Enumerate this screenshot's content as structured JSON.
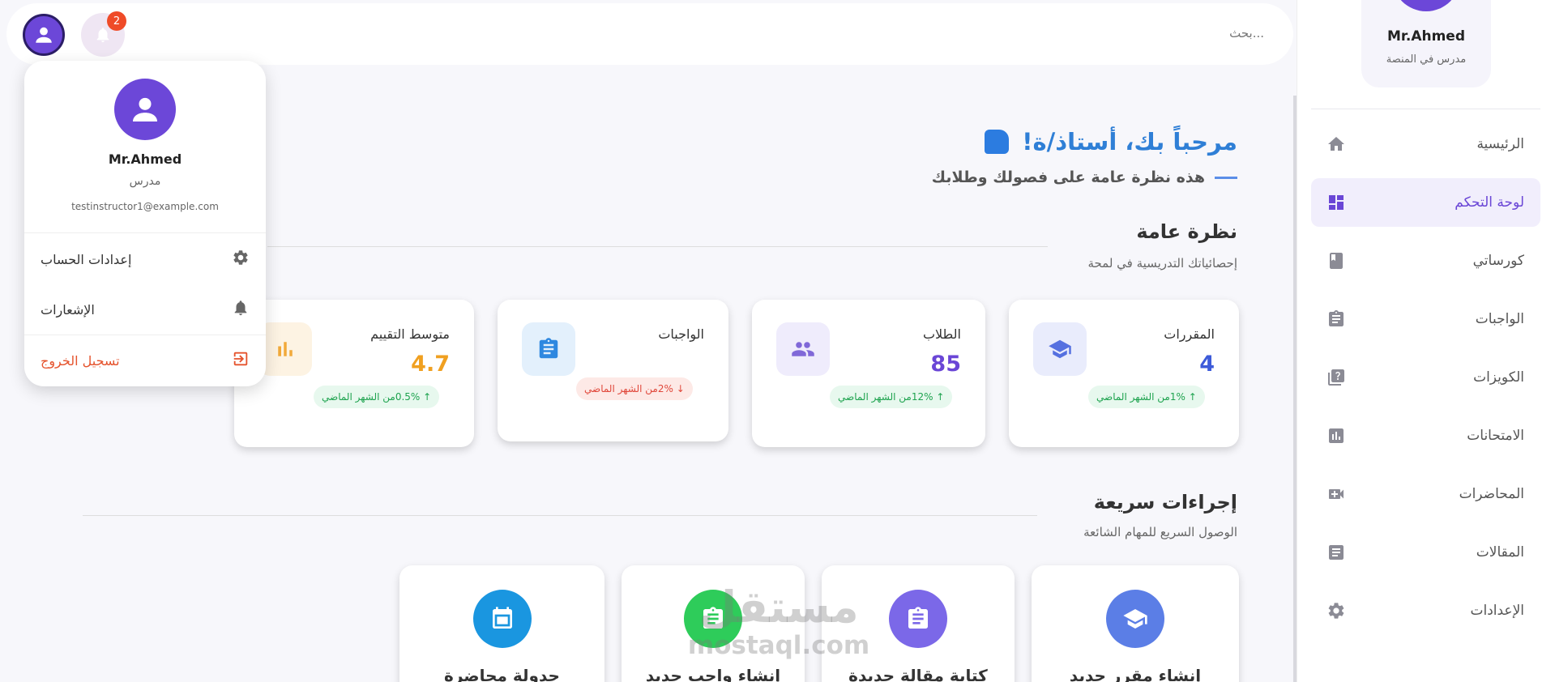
{
  "sidebar": {
    "profile_name": "Mr.Ahmed",
    "profile_role": "مدرس في المنصة",
    "items": [
      {
        "label": "الرئيسية",
        "icon": "home-icon",
        "active": false
      },
      {
        "label": "لوحة التحكم",
        "icon": "dashboard-icon",
        "active": true
      },
      {
        "label": "كورساتي",
        "icon": "book-icon",
        "active": false
      },
      {
        "label": "الواجبات",
        "icon": "clipboard-icon",
        "active": false
      },
      {
        "label": "الكويزات",
        "icon": "quiz-icon",
        "active": false
      },
      {
        "label": "الامتحانات",
        "icon": "chart-icon",
        "active": false
      },
      {
        "label": "المحاضرات",
        "icon": "video-icon",
        "active": false
      },
      {
        "label": "المقالات",
        "icon": "article-icon",
        "active": false
      },
      {
        "label": "الإعدادات",
        "icon": "gear-icon",
        "active": false
      }
    ]
  },
  "topbar": {
    "search_placeholder": "بحث...",
    "notification_count": "2"
  },
  "welcome": {
    "title": "مرحباً بك، أستاذ/ة!",
    "subtitle": "هذه نظرة عامة على فصولك وطلابك"
  },
  "overview": {
    "title": "نظرة عامة",
    "subtitle": "إحصائياتك التدريسية في لمحة",
    "stats": [
      {
        "label": "المقررات",
        "value": "4",
        "change": "↑ 1%من الشهر الماضي",
        "trend": "up",
        "color": "#3d5bd9",
        "icon_bg": "#e9ecfc",
        "icon_color": "#5570e0"
      },
      {
        "label": "الطلاب",
        "value": "85",
        "change": "↑ 12%من الشهر الماضي",
        "trend": "up",
        "color": "#6a46d6",
        "icon_bg": "#efecfc",
        "icon_color": "#8068d8"
      },
      {
        "label": "الواجبات",
        "value": "",
        "change": "↓ 2%من الشهر الماضي",
        "trend": "down",
        "color": "#2f7fd6",
        "icon_bg": "#e3f0fc",
        "icon_color": "#2e88e0"
      },
      {
        "label": "متوسط التقييم",
        "value": "4.7",
        "change": "↑ 0.5%من الشهر الماضي",
        "trend": "up",
        "color": "#f0a020",
        "icon_bg": "#fdf3e3",
        "icon_color": "#f2a93a"
      }
    ]
  },
  "quick_actions": {
    "title": "إجراءات سريعة",
    "subtitle": "الوصول السريع للمهام الشائعة",
    "items": [
      {
        "label": "إنشاء مقرر جديد",
        "icon": "graduation-cap-icon",
        "color": "#5b7ee6"
      },
      {
        "label": "كتابة مقالة جديدة",
        "icon": "clipboard-icon",
        "color": "#7b68e8"
      },
      {
        "label": "إنشاء واجب جديد",
        "icon": "clipboard-icon",
        "color": "#2ecc5a"
      },
      {
        "label": "جدولة محاضرة",
        "icon": "calendar-icon",
        "color": "#1a96e0"
      }
    ]
  },
  "watermark": {
    "brand": "مستقل",
    "domain": "mostaql.com"
  },
  "dropdown": {
    "name": "Mr.Ahmed",
    "role": "مدرس",
    "email": "testinstructor1@example.com",
    "account_settings": "إعدادات الحساب",
    "notifications": "الإشعارات",
    "logout": "تسجيل الخروج"
  }
}
